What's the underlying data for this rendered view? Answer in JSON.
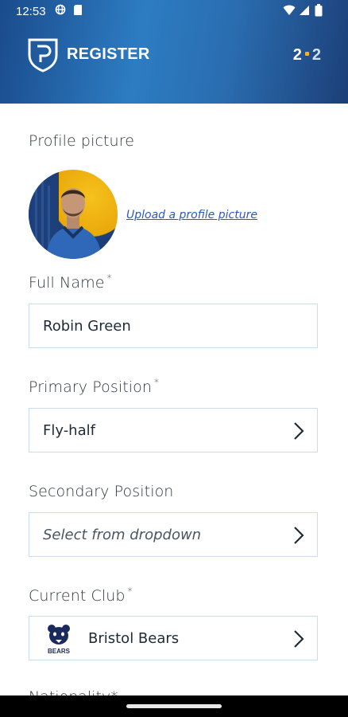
{
  "status_bar": {
    "time": "12:53"
  },
  "header": {
    "title": "REGISTER",
    "step_current": "2",
    "step_total": "2"
  },
  "profile": {
    "label": "Profile picture",
    "upload_link": "Upload a profile picture"
  },
  "full_name": {
    "label": "Full Name",
    "required_mark": "*",
    "value": "Robin Green"
  },
  "primary_position": {
    "label": "Primary Position",
    "required_mark": "*",
    "value": "Fly-half"
  },
  "secondary_position": {
    "label": "Secondary Position",
    "placeholder": "Select from dropdown"
  },
  "current_club": {
    "label": "Current Club",
    "required_mark": "*",
    "value": "Bristol Bears",
    "logo_text": "BEARS"
  },
  "nationality": {
    "label": "Nationality",
    "required_mark": "*"
  },
  "colors": {
    "header_blue": "#2d7cc2",
    "accent_yellow": "#f2b619",
    "field_border": "#c9ddef",
    "link": "#2a5ab8"
  }
}
